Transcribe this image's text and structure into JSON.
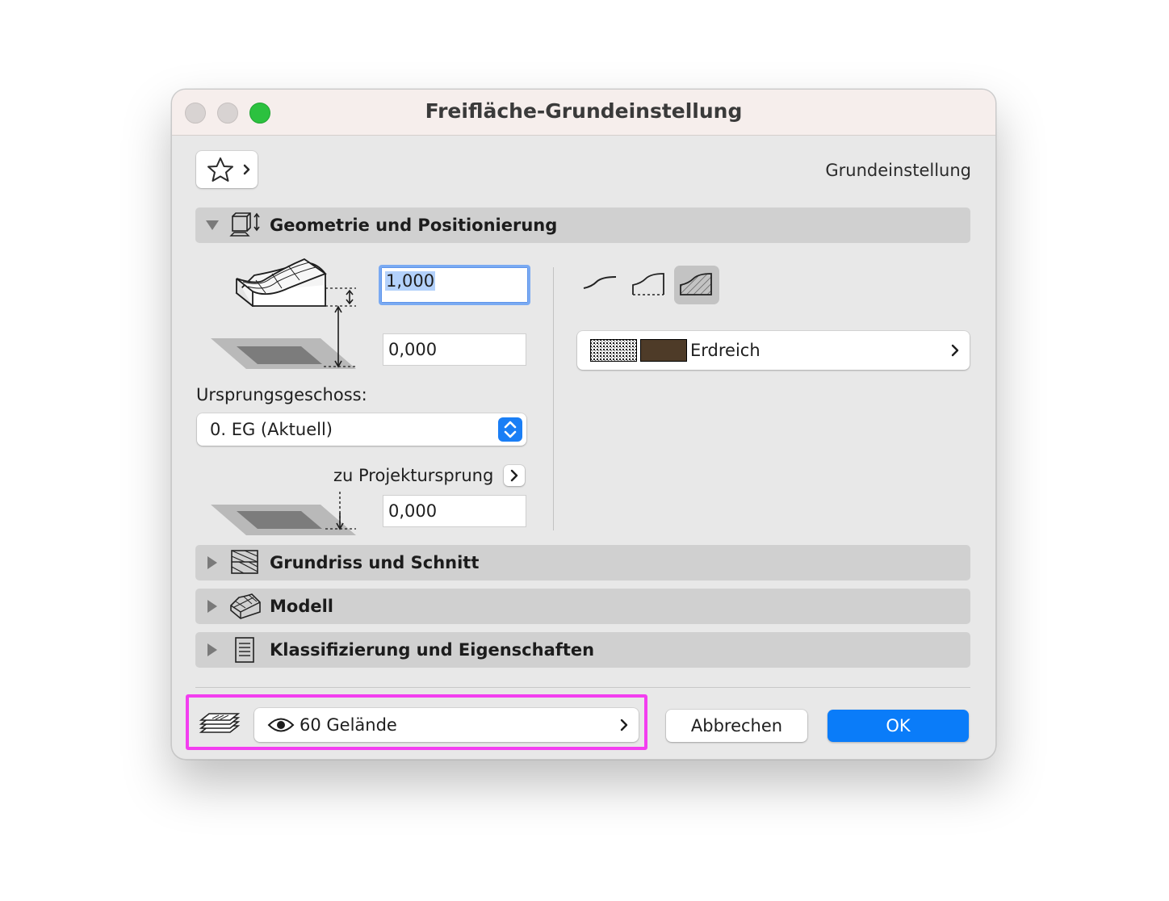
{
  "window": {
    "title": "Freifläche-Grundeinstellung",
    "preset_label": "Grundeinstellung"
  },
  "sections": {
    "geometry": "Geometrie und Positionierung",
    "floorplan": "Grundriss und Schnitt",
    "model": "Modell",
    "classification": "Klassifizierung und Eigenschaften"
  },
  "geometry": {
    "thickness_value": "1,000",
    "offset_value": "0,000",
    "home_story_label": "Ursprungsgeschoss:",
    "home_story_value": "0. EG (Aktuell)",
    "project_origin_label": "zu Projektursprung",
    "origin_offset_value": "0,000",
    "surface_material": "Erdreich"
  },
  "footer": {
    "layer_value": "60 Gelände",
    "cancel_label": "Abbrechen",
    "ok_label": "OK"
  },
  "colors": {
    "accent": "#0a7cf9",
    "highlight": "#f33ef0",
    "material_swatch": "#4e3b28"
  }
}
